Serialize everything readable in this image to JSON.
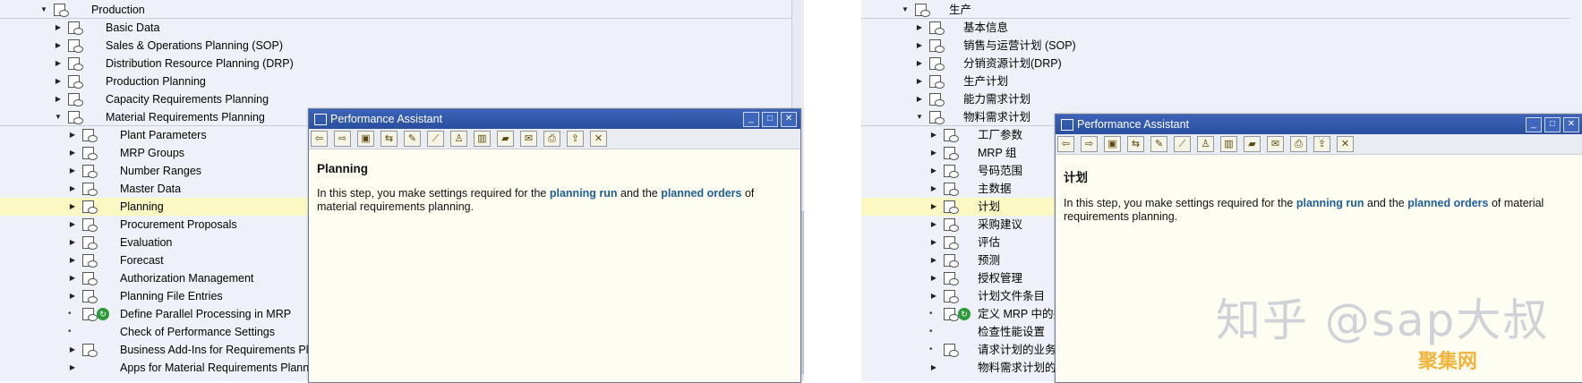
{
  "left_pane": {
    "rows": [
      {
        "label": "Production",
        "arrow": "▼"
      },
      {
        "label": "Basic Data",
        "arrow": "▶"
      },
      {
        "label": "Sales & Operations Planning (SOP)",
        "arrow": "▶"
      },
      {
        "label": "Distribution Resource Planning (DRP)",
        "arrow": "▶"
      },
      {
        "label": "Production Planning",
        "arrow": "▶"
      },
      {
        "label": "Capacity Requirements Planning",
        "arrow": "▶"
      },
      {
        "label": "Material Requirements Planning",
        "arrow": "▼"
      },
      {
        "label": "Plant Parameters",
        "arrow": "▶"
      },
      {
        "label": "MRP Groups",
        "arrow": "▶"
      },
      {
        "label": "Number Ranges",
        "arrow": "▶"
      },
      {
        "label": "Master Data",
        "arrow": "▶"
      },
      {
        "label": "Planning",
        "arrow": "▶"
      },
      {
        "label": "Procurement Proposals",
        "arrow": "▶"
      },
      {
        "label": "Evaluation",
        "arrow": "▶"
      },
      {
        "label": "Forecast",
        "arrow": "▶"
      },
      {
        "label": "Authorization Management",
        "arrow": "▶"
      },
      {
        "label": "Planning File Entries",
        "arrow": "▶"
      },
      {
        "label": "Define Parallel Processing in MRP",
        "arrow": "•"
      },
      {
        "label": "Check of Performance Settings",
        "arrow": "•"
      },
      {
        "label": "Business Add-Ins for Requirements Plan",
        "arrow": "▶"
      },
      {
        "label": "Apps for Material Requirements Plannin",
        "arrow": "▶"
      }
    ]
  },
  "right_pane": {
    "rows": [
      {
        "label": "生产",
        "arrow": "▼"
      },
      {
        "label": "基本信息",
        "arrow": "▶"
      },
      {
        "label": "销售与运营计划 (SOP)",
        "arrow": "▶"
      },
      {
        "label": "分销资源计划(DRP)",
        "arrow": "▶"
      },
      {
        "label": "生产计划",
        "arrow": "▶"
      },
      {
        "label": "能力需求计划",
        "arrow": "▶"
      },
      {
        "label": "物料需求计划",
        "arrow": "▼"
      },
      {
        "label": "工厂参数",
        "arrow": "▶"
      },
      {
        "label": "MRP 组",
        "arrow": "▶"
      },
      {
        "label": "号码范围",
        "arrow": "▶"
      },
      {
        "label": "主数据",
        "arrow": "▶"
      },
      {
        "label": "计划",
        "arrow": "▶"
      },
      {
        "label": "采购建议",
        "arrow": "▶"
      },
      {
        "label": "评估",
        "arrow": "▶"
      },
      {
        "label": "预测",
        "arrow": "▶"
      },
      {
        "label": "授权管理",
        "arrow": "▶"
      },
      {
        "label": "计划文件条目",
        "arrow": "▶"
      },
      {
        "label": "定义 MRP 中的并",
        "arrow": "•"
      },
      {
        "label": "检查性能设置",
        "arrow": "•"
      },
      {
        "label": "请求计划的业务",
        "arrow": "•"
      },
      {
        "label": "物料需求计划的",
        "arrow": "▶"
      }
    ]
  },
  "assistant_left": {
    "window_title": "Performance Assistant",
    "heading": "Planning",
    "text_before": "In this step, you make settings required for the ",
    "kw1": "planning run",
    "text_mid": " and the ",
    "kw2": "planned orders",
    "text_after": " of material requirements planning."
  },
  "assistant_right": {
    "window_title": "Performance Assistant",
    "heading": "计划",
    "text_before": "In this step, you make settings required for the ",
    "kw1": "planning run",
    "text_mid": " and the ",
    "kw2": "planned orders",
    "text_after": " of material requirements planning."
  },
  "toolbar_icons": [
    "back-icon",
    "forward-icon",
    "print-preview-icon",
    "structure-icon",
    "edit-icon",
    "link-icon",
    "person-icon",
    "book-icon",
    "note-icon",
    "comment-icon",
    "print-icon",
    "export-icon",
    "close-icon"
  ],
  "window_buttons": {
    "minimize": "_",
    "maximize": "□",
    "close": "✕"
  },
  "watermark": {
    "text": "知乎 @sap大叔",
    "logo": "聚集网"
  }
}
